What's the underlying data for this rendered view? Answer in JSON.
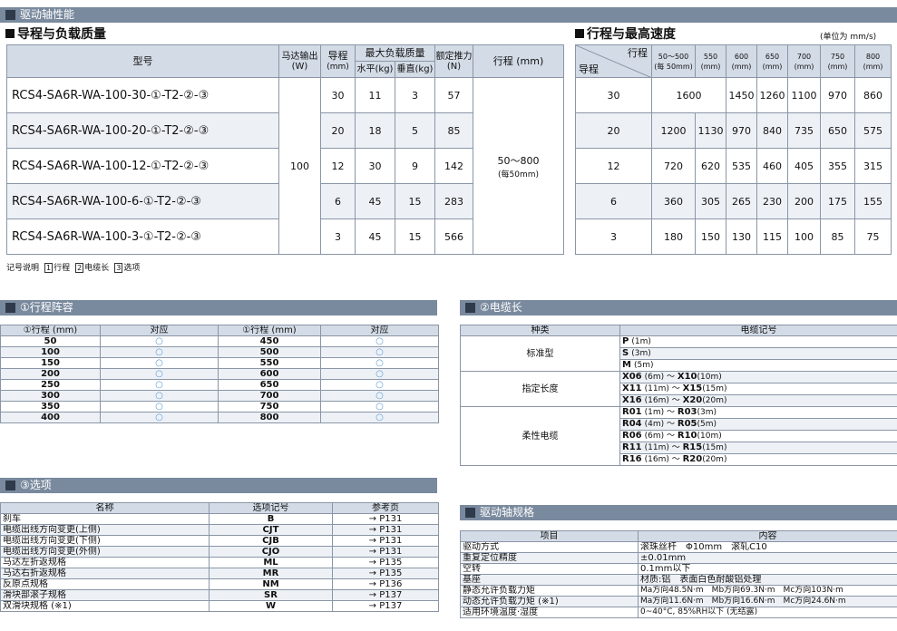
{
  "header_title": "驱动轴性能",
  "sec_left_title": "导程与负载质量",
  "sec_right_title": "行程与最高速度",
  "unit_note": "(单位为 mm/s)",
  "load_table": {
    "h_model": "型号",
    "h_motor": "马达输出",
    "h_motor_u": "(W)",
    "h_lead": "导程",
    "h_lead_u": "(mm)",
    "h_maxload": "最大负载质量",
    "h_horiz": "水平(kg)",
    "h_vert": "垂直(kg)",
    "h_thrust": "额定推力",
    "h_thrust_u": "(N)",
    "h_stroke": "行程 (mm)",
    "motor": "100",
    "stroke": "50～800",
    "stroke_step": "(每50mm)",
    "rows": [
      {
        "model": "RCS4-SA6R-WA-100-30-①-T2-②-③",
        "lead": "30",
        "h": "11",
        "v": "3",
        "thrust": "57"
      },
      {
        "model": "RCS4-SA6R-WA-100-20-①-T2-②-③",
        "lead": "20",
        "h": "18",
        "v": "5",
        "thrust": "85"
      },
      {
        "model": "RCS4-SA6R-WA-100-12-①-T2-②-③",
        "lead": "12",
        "h": "30",
        "v": "9",
        "thrust": "142"
      },
      {
        "model": "RCS4-SA6R-WA-100-6-①-T2-②-③",
        "lead": "6",
        "h": "45",
        "v": "15",
        "thrust": "283"
      },
      {
        "model": "RCS4-SA6R-WA-100-3-①-T2-②-③",
        "lead": "3",
        "h": "45",
        "v": "15",
        "thrust": "566"
      }
    ]
  },
  "legend": {
    "label": "记号说明",
    "i1": "1",
    "t1": "行程",
    "i2": "2",
    "t2": "电缆长",
    "i3": "3",
    "t3": "选项"
  },
  "speed_table": {
    "h_stroke": "行程",
    "h_lead": "导程",
    "cols": [
      [
        "50～500",
        "(每 50mm)"
      ],
      [
        "550",
        "(mm)"
      ],
      [
        "600",
        "(mm)"
      ],
      [
        "650",
        "(mm)"
      ],
      [
        "700",
        "(mm)"
      ],
      [
        "750",
        "(mm)"
      ],
      [
        "800",
        "(mm)"
      ]
    ],
    "rows": [
      {
        "lead": "30",
        "first": "1600",
        "vals": [
          "1450",
          "1260",
          "1100",
          "970",
          "860"
        ]
      },
      {
        "lead": "20",
        "vals": [
          "1200",
          "1130",
          "970",
          "840",
          "735",
          "650",
          "575"
        ]
      },
      {
        "lead": "12",
        "vals": [
          "720",
          "620",
          "535",
          "460",
          "405",
          "355",
          "315"
        ]
      },
      {
        "lead": "6",
        "vals": [
          "360",
          "305",
          "265",
          "230",
          "200",
          "175",
          "155"
        ]
      },
      {
        "lead": "3",
        "vals": [
          "180",
          "150",
          "130",
          "115",
          "100",
          "85",
          "75"
        ]
      }
    ]
  },
  "stroke_sec": {
    "title": "①行程阵容",
    "h1": "①行程 (mm)",
    "h2": "对应",
    "mark": "○",
    "left": [
      "50",
      "100",
      "150",
      "200",
      "250",
      "300",
      "350",
      "400"
    ],
    "right": [
      "450",
      "500",
      "550",
      "600",
      "650",
      "700",
      "750",
      "800"
    ]
  },
  "cable_sec": {
    "title": "②电缆长",
    "h1": "种类",
    "h2": "电缆记号",
    "groups": [
      {
        "type": "标准型",
        "items": [
          [
            "P",
            "(1m)"
          ],
          [
            "S",
            "(3m)"
          ],
          [
            "M",
            "(5m)"
          ]
        ]
      },
      {
        "type": "指定长度",
        "items": [
          [
            "X06",
            "(6m) ～ ",
            "X10",
            "(10m)"
          ],
          [
            "X11",
            "(11m) ～ ",
            "X15",
            "(15m)"
          ],
          [
            "X16",
            "(16m) ～ ",
            "X20",
            "(20m)"
          ]
        ]
      },
      {
        "type": "柔性电缆",
        "items": [
          [
            "R01",
            "(1m) ～ ",
            "R03",
            "(3m)"
          ],
          [
            "R04",
            "(4m) ～ ",
            "R05",
            "(5m)"
          ],
          [
            "R06",
            "(6m) ～ ",
            "R10",
            "(10m)"
          ],
          [
            "R11",
            "(11m) ～ ",
            "R15",
            "(15m)"
          ],
          [
            "R16",
            "(16m) ～ ",
            "R20",
            "(20m)"
          ]
        ]
      }
    ]
  },
  "option_sec": {
    "title": "③选项",
    "h1": "名称",
    "h2": "选项记号",
    "h3": "参考页",
    "rows": [
      [
        "刹车",
        "B",
        "→ P131"
      ],
      [
        "电缆出线方向变更(上侧)",
        "CJT",
        "→ P131"
      ],
      [
        "电缆出线方向变更(下侧)",
        "CJB",
        "→ P131"
      ],
      [
        "电缆出线方向变更(外侧)",
        "CJO",
        "→ P131"
      ],
      [
        "马达左折返规格",
        "ML",
        "→ P135"
      ],
      [
        "马达右折返规格",
        "MR",
        "→ P135"
      ],
      [
        "反原点规格",
        "NM",
        "→ P136"
      ],
      [
        "滑块部滚子规格",
        "SR",
        "→ P137"
      ],
      [
        "双滑块规格 (※1)",
        "W",
        "→ P137"
      ]
    ]
  },
  "spec_sec": {
    "title": "驱动轴规格",
    "h1": "项目",
    "h2": "内容",
    "rows": [
      [
        "驱动方式",
        "滚珠丝杆　Φ10mm　滚轧C10"
      ],
      [
        "重复定位精度",
        "±0.01mm"
      ],
      [
        "空转",
        "0.1mm以下"
      ],
      [
        "基座",
        "材质:铝　表面白色耐酸铝处理"
      ],
      [
        "静态允许负载力矩",
        "Ma方向48.5N·m　Mb方向69.3N·m　Mc方向103N·m"
      ],
      [
        "动态允许负载力矩 (※1)",
        "Ma方向11.6N·m　Mb方向16.6N·m　Mc方向24.6N·m"
      ],
      [
        "适用环境温度·湿度",
        "0~40°C, 85%RH以下 (无结露)"
      ]
    ]
  }
}
